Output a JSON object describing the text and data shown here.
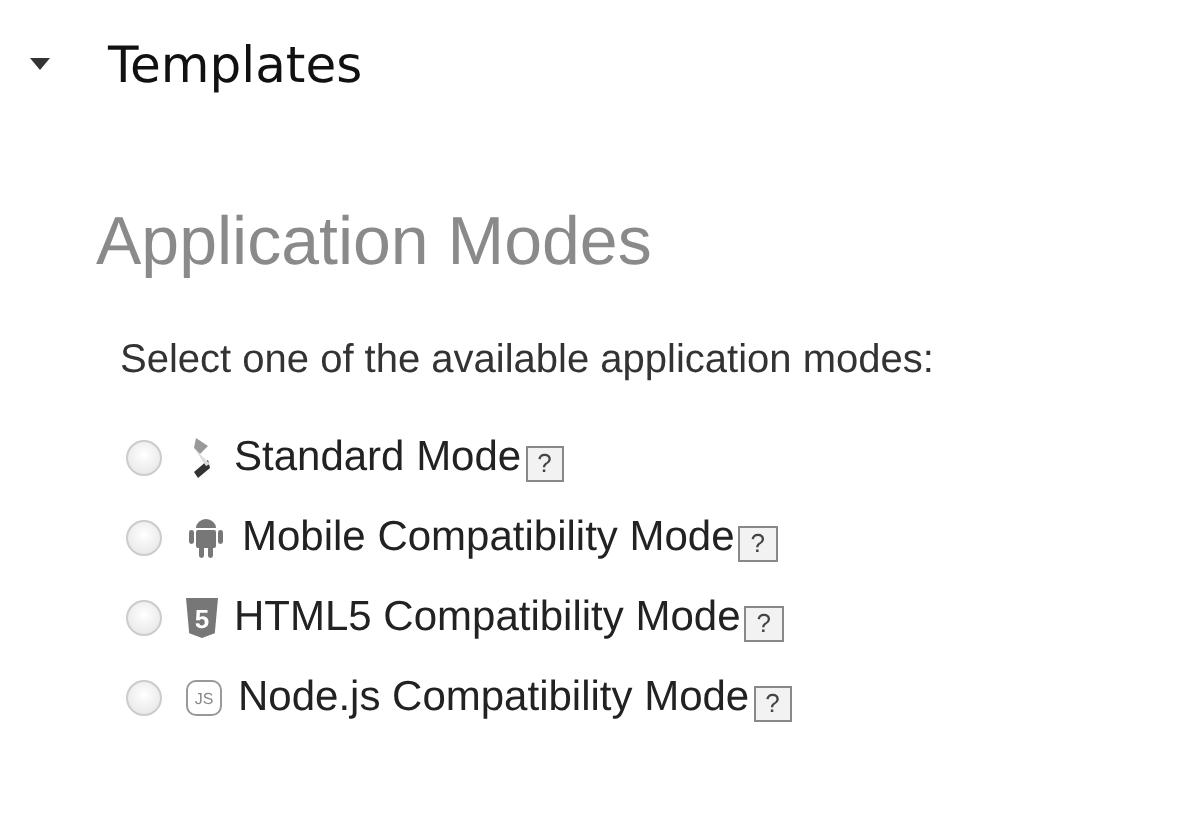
{
  "section": {
    "title": "Templates",
    "expanded": true
  },
  "heading": "Application Modes",
  "prompt": "Select one of the available application modes:",
  "modes": [
    {
      "kind": "standard",
      "label": "Standard Mode",
      "help": "?",
      "selected": false
    },
    {
      "kind": "android",
      "label": "Mobile Compatibility Mode",
      "help": "?",
      "selected": false
    },
    {
      "kind": "html5",
      "label": "HTML5 Compatibility Mode",
      "help": "?",
      "selected": false,
      "icon_text": "5"
    },
    {
      "kind": "nodejs",
      "label": "Node.js Compatibility Mode",
      "help": "?",
      "selected": false,
      "icon_text": "JS"
    }
  ]
}
